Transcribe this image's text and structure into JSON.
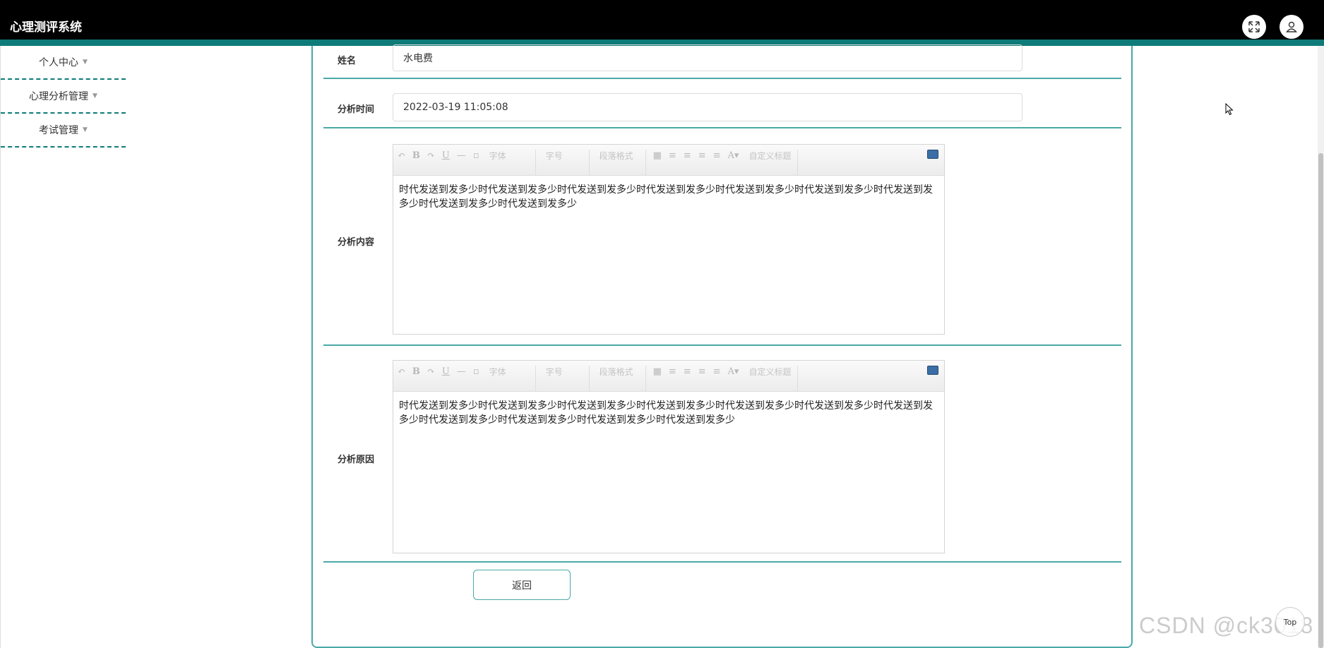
{
  "app": {
    "title": "心理测评系统"
  },
  "header": {
    "fullscreen_icon": "fullscreen-icon",
    "user_icon": "user-icon"
  },
  "sidebar": {
    "items": [
      {
        "label": "个人中心"
      },
      {
        "label": "心理分析管理"
      },
      {
        "label": "考试管理"
      }
    ]
  },
  "form": {
    "name_label": "姓名",
    "name_value": "水电费",
    "time_label": "分析时间",
    "time_value": "2022-03-19 11:05:08",
    "content_label": "分析内容",
    "content_value": "时代发送到发多少时代发送到发多少时代发送到发多少时代发送到发多少时代发送到发多少时代发送到发多少时代发送到发多少时代发送到发多少时代发送到发多少",
    "reason_label": "分析原因",
    "reason_value": "时代发送到发多少时代发送到发多少时代发送到发多少时代发送到发多少时代发送到发多少时代发送到发多少时代发送到发多少时代发送到发多少时代发送到发多少时代发送到发多少时代发送到发多少",
    "back_label": "返回"
  },
  "editor_toolbar": {
    "font_label": "字体",
    "size_label": "字号",
    "paragraph_label": "段落格式",
    "custom_title_label": "自定义标题"
  },
  "top_button": {
    "label": "Top"
  },
  "watermark": "CSDN @ck3018",
  "colors": {
    "header_bg": "#000000",
    "accent": "#0e7b79",
    "border": "#4aa9a7"
  }
}
